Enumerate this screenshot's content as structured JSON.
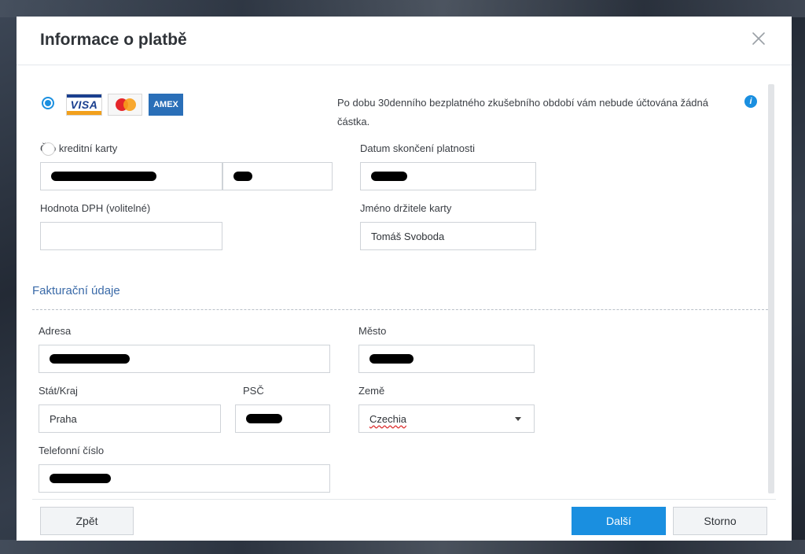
{
  "dialog": {
    "title": "Informace o platbě",
    "close_icon": "close-icon"
  },
  "payment": {
    "card_brands": [
      "VISA",
      "AMEX"
    ],
    "info_text": "Po dobu 30denního bezplatného zkušebního období vám nebude účtována žádná částka.",
    "info_icon_glyph": "i",
    "card_number_label": "Č  o kreditní karty",
    "expiry_label": "Datum skončení platnosti",
    "vat_label": "Hodnota DPH (volitelné)",
    "vat_value": "",
    "holder_label": "Jméno držitele karty",
    "holder_value": "Tomáš Svoboda"
  },
  "billing": {
    "section_title": "Fakturační údaje",
    "address_label": "Adresa",
    "city_label": "Město",
    "state_label": "Stát/Kraj",
    "state_value": "Praha",
    "zip_label": "PSČ",
    "country_label": "Země",
    "country_value": "Czechia",
    "phone_label": "Telefonní číslo"
  },
  "footer": {
    "back_label": "Zpět",
    "next_label": "Další",
    "cancel_label": "Storno"
  },
  "colors": {
    "accent": "#1a8fe0",
    "section_title": "#3a6aa8"
  }
}
